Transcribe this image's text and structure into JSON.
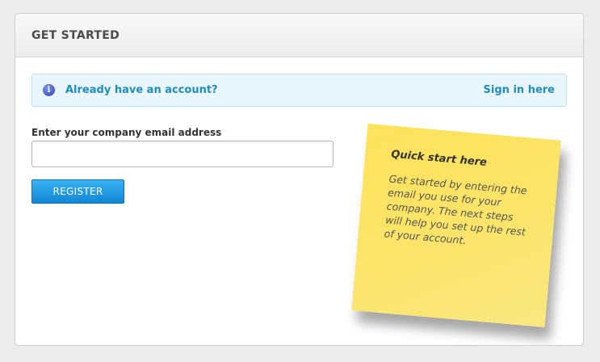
{
  "panel": {
    "title": "GET STARTED"
  },
  "info_bar": {
    "icon": "info-icon",
    "text": "Already have an account?",
    "link_label": "Sign in here"
  },
  "form": {
    "email_label": "Enter your company email address",
    "email_value": "",
    "email_placeholder": "",
    "register_label": "REGISTER"
  },
  "sticky_note": {
    "title": "Quick start here",
    "body": "Get started by entering the email you use for your company. The next steps will help you set up the rest of your account."
  },
  "colors": {
    "accent": "#1f8dc2",
    "button": "#1a96e0",
    "note": "#fbe46a"
  }
}
